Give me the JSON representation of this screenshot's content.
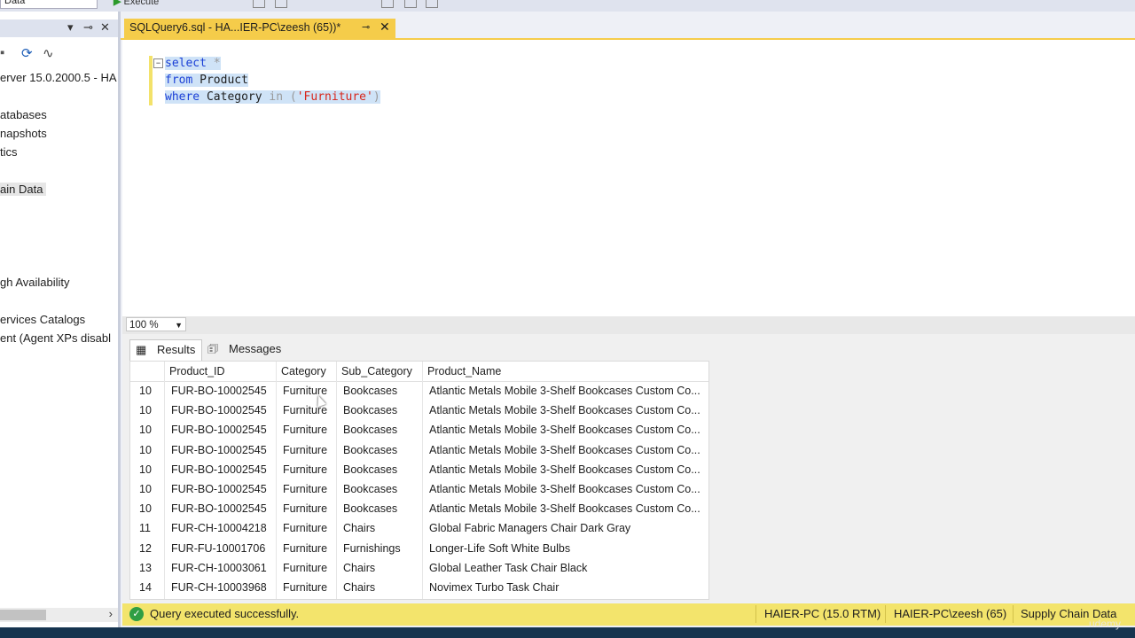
{
  "toolbar": {
    "database_value": "Data",
    "execute_label": "Execute"
  },
  "explorer": {
    "tree_items": [
      "erver 15.0.2000.5 - HA",
      "atabases",
      "napshots",
      "tics",
      "ain Data",
      "gh Availability",
      "ervices Catalogs",
      "ent (Agent XPs disabl"
    ]
  },
  "tab": {
    "title": "SQLQuery6.sql - HA...IER-PC\\zeesh (65))*",
    "pin": "⊸",
    "close": "✕"
  },
  "editor": {
    "line1_kw": "select",
    "line1_rest": " *",
    "line2_kw": "from",
    "line2_rest": " Product",
    "line3_kw": "where",
    "line3_ident": " Category ",
    "line3_in": "in (",
    "line3_str": "'Furniture'",
    "line3_close": ")"
  },
  "zoom": {
    "value": "100 %"
  },
  "results": {
    "tabs": [
      "Results",
      "Messages"
    ],
    "columns": [
      "",
      "Product_ID",
      "Category",
      "Sub_Category",
      "Product_Name"
    ],
    "rows": [
      [
        "10",
        "FUR-BO-10002545",
        "Furniture",
        "Bookcases",
        "Atlantic Metals Mobile 3-Shelf Bookcases  Custom Co..."
      ],
      [
        "10",
        "FUR-BO-10002545",
        "Furniture",
        "Bookcases",
        "Atlantic Metals Mobile 3-Shelf Bookcases  Custom Co..."
      ],
      [
        "10",
        "FUR-BO-10002545",
        "Furniture",
        "Bookcases",
        "Atlantic Metals Mobile 3-Shelf Bookcases  Custom Co..."
      ],
      [
        "10",
        "FUR-BO-10002545",
        "Furniture",
        "Bookcases",
        "Atlantic Metals Mobile 3-Shelf Bookcases  Custom Co..."
      ],
      [
        "10",
        "FUR-BO-10002545",
        "Furniture",
        "Bookcases",
        "Atlantic Metals Mobile 3-Shelf Bookcases  Custom Co..."
      ],
      [
        "10",
        "FUR-BO-10002545",
        "Furniture",
        "Bookcases",
        "Atlantic Metals Mobile 3-Shelf Bookcases  Custom Co..."
      ],
      [
        "10",
        "FUR-BO-10002545",
        "Furniture",
        "Bookcases",
        "Atlantic Metals Mobile 3-Shelf Bookcases  Custom Co..."
      ],
      [
        "11",
        "FUR-CH-10004218",
        "Furniture",
        "Chairs",
        "Global Fabric Managers Chair  Dark Gray"
      ],
      [
        "12",
        "FUR-FU-10001706",
        "Furniture",
        "Furnishings",
        "Longer-Life Soft White Bulbs"
      ],
      [
        "13",
        "FUR-CH-10003061",
        "Furniture",
        "Chairs",
        "Global Leather Task Chair  Black"
      ],
      [
        "14",
        "FUR-CH-10003968",
        "Furniture",
        "Chairs",
        "Novimex Turbo Task Chair"
      ]
    ]
  },
  "status": {
    "message": "Query executed successfully.",
    "server": "HAIER-PC (15.0 RTM)",
    "user": "HAIER-PC\\zeesh (65)",
    "database": "Supply Chain Data"
  },
  "watermark": "udemy",
  "colors": {
    "status_bar": "#f3e46c",
    "tab_active": "#f5cc4a",
    "keyword": "#1a3fd6",
    "string": "#d7261b",
    "success": "#2f9e44"
  }
}
